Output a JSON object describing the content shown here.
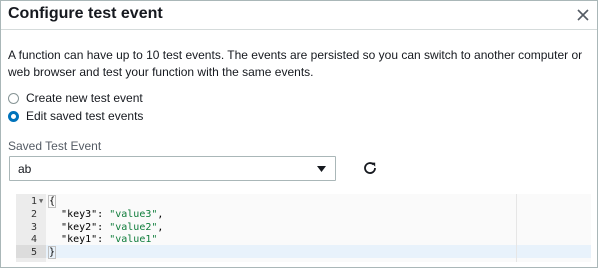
{
  "dialog": {
    "title": "Configure test event",
    "description": "A function can have up to 10 test events. The events are persisted so you can switch to another computer or web browser and test your function with the same events."
  },
  "options": [
    {
      "label": "Create new test event",
      "selected": false
    },
    {
      "label": "Edit saved test events",
      "selected": true
    }
  ],
  "saved": {
    "label": "Saved Test Event",
    "value": "ab"
  },
  "editor": {
    "lines": [
      {
        "num": "1",
        "text": "{"
      },
      {
        "num": "2",
        "key": "\"key3\"",
        "sep": ": ",
        "val": "\"value3\"",
        "end": ","
      },
      {
        "num": "3",
        "key": "\"key2\"",
        "sep": ": ",
        "val": "\"value2\"",
        "end": ","
      },
      {
        "num": "4",
        "key": "\"key1\"",
        "sep": ": ",
        "val": "\"value1\"",
        "end": ""
      },
      {
        "num": "5",
        "text": "}"
      }
    ]
  },
  "colors": {
    "accent": "#0073bb",
    "string": "#0e7c3a"
  },
  "icons": {
    "close": "close-icon",
    "caret": "caret-down-icon",
    "refresh": "refresh-icon"
  }
}
